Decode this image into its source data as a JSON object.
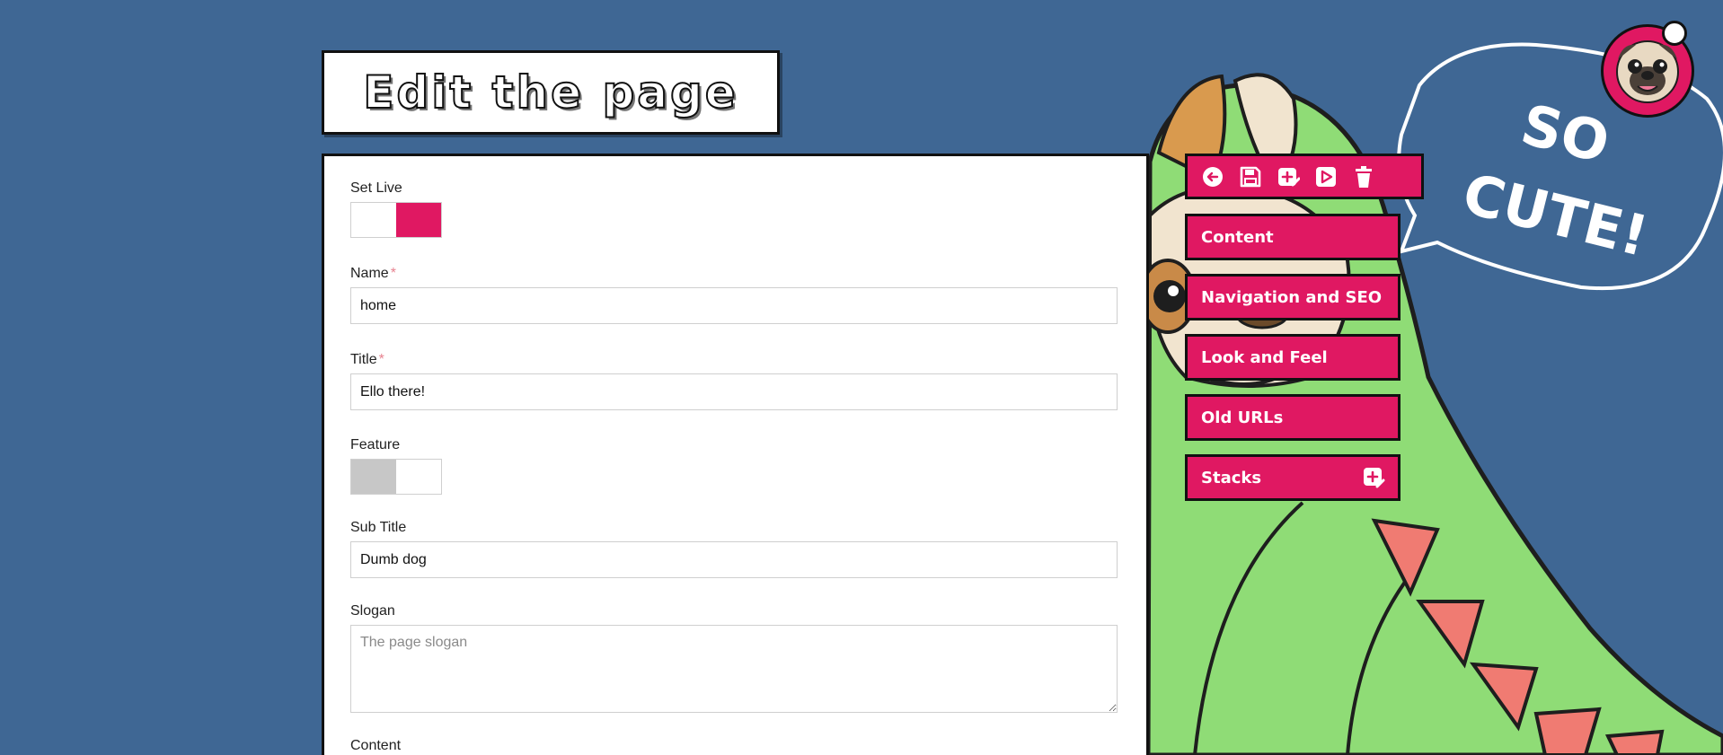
{
  "heading": {
    "title": "Edit the page"
  },
  "form": {
    "set_live": {
      "label": "Set Live",
      "state": "on"
    },
    "name": {
      "label": "Name",
      "required_mark": "*",
      "value": "home"
    },
    "title": {
      "label": "Title",
      "required_mark": "*",
      "value": "Ello there!"
    },
    "feature": {
      "label": "Feature",
      "state": "off"
    },
    "sub_title": {
      "label": "Sub Title",
      "value": "Dumb dog"
    },
    "slogan": {
      "label": "Slogan",
      "value": "",
      "placeholder": "The page slogan"
    },
    "content": {
      "label": "Content"
    }
  },
  "toolbar": {
    "icons": [
      "back-icon",
      "save-icon",
      "new-page-icon",
      "preview-icon",
      "delete-icon"
    ]
  },
  "sections": [
    {
      "label": "Content"
    },
    {
      "label": "Navigation and SEO"
    },
    {
      "label": "Look and Feel"
    },
    {
      "label": "Old URLs"
    },
    {
      "label": "Stacks",
      "icon": "add-stack-icon"
    }
  ],
  "speech_bubble": {
    "line1": "SO",
    "line2": "CUTE!"
  },
  "colors": {
    "background": "#3f6794",
    "accent": "#e01862",
    "border": "#111111",
    "dino": "#8fdc76",
    "spikes": "#f07b72"
  }
}
